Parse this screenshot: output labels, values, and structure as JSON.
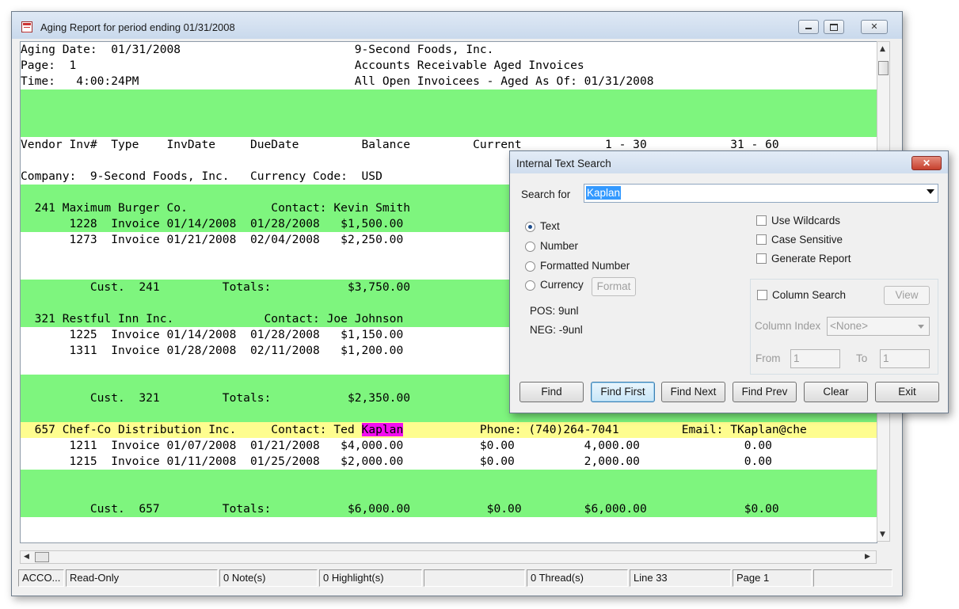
{
  "window": {
    "title": "Aging Report for period ending 01/31/2008"
  },
  "report": {
    "header": [
      "Aging Date:  01/31/2008                         9-Second Foods, Inc.",
      "Page:  1                                        Accounts Receivable Aged Invoices",
      "Time:   4:00:24PM                               All Open Invoicees - Aged As Of: 01/31/2008"
    ],
    "column_header": "Vendor Inv#  Type    InvDate     DueDate         Balance         Current            1 - 30            31 - 60",
    "company_line": "Company:  9-Second Foods, Inc.   Currency Code:  USD",
    "customers": [
      {
        "header": "  241 Maximum Burger Co.            Contact: Kevin Smith",
        "invoices": [
          "       1228  Invoice 01/14/2008  01/28/2008   $1,500.00",
          "       1273  Invoice 01/21/2008  02/04/2008   $2,250.00"
        ],
        "totals": "          Cust.  241         Totals:           $3,750.00"
      },
      {
        "header": "  321 Restful Inn Inc.             Contact: Joe Johnson",
        "invoices": [
          "       1225  Invoice 01/14/2008  01/28/2008   $1,150.00",
          "       1311  Invoice 01/28/2008  02/11/2008   $1,200.00"
        ],
        "totals": "          Cust.  321         Totals:           $2,350.00"
      },
      {
        "header_pre": "  657 Chef-Co Distribution Inc.     Contact: Ted ",
        "header_match": "Kaplan",
        "header_post": "           Phone: (740)264-7041         Email: TKaplan@che",
        "invoices": [
          "       1211  Invoice 01/07/2008  01/21/2008   $4,000.00           $0.00          4,000.00               0.00",
          "       1215  Invoice 01/11/2008  01/25/2008   $2,000.00           $0.00          2,000.00               0.00"
        ],
        "totals": "          Cust.  657         Totals:           $6,000.00           $0.00         $6,000.00              $0.00"
      }
    ]
  },
  "status_bar": [
    "ACCO...",
    "Read-Only",
    "0 Note(s)",
    "0 Highlight(s)",
    "",
    "0 Thread(s)",
    "Line 33",
    "Page 1",
    ""
  ],
  "dialog": {
    "title": "Internal Text Search",
    "search_label": "Search for",
    "search_value": "Kaplan",
    "radio_options": [
      "Text",
      "Number",
      "Formatted Number",
      "Currency"
    ],
    "selected_radio": "Text",
    "format_button": "Format",
    "pos_label": "POS: 9unl",
    "neg_label": "NEG: -9unl",
    "checkboxes": [
      "Use Wildcards",
      "Case Sensitive",
      "Generate Report"
    ],
    "column_search_label": "Column Search",
    "view_button": "View",
    "column_index_label": "Column Index",
    "column_index_value": "<None>",
    "from_label": "From",
    "from_value": "1",
    "to_label": "To",
    "to_value": "1",
    "buttons": [
      "Find",
      "Find First",
      "Find Next",
      "Find Prev",
      "Clear",
      "Exit"
    ]
  },
  "colors": {
    "green_band": "#7ef57e",
    "yellow_band": "#fefd8f",
    "match_highlight": "#f30ef0"
  }
}
